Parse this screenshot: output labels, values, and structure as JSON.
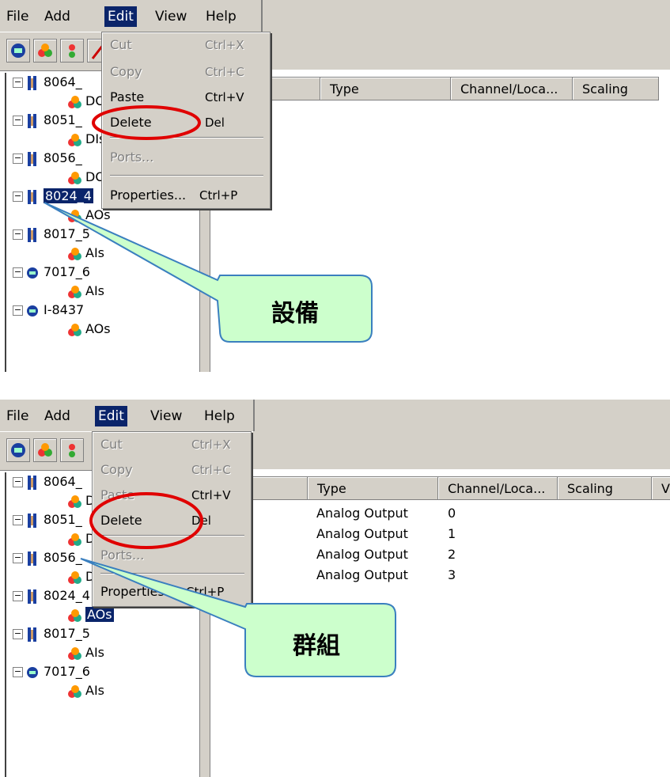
{
  "menu": [
    "File",
    "Add",
    "Edit",
    "View",
    "Help"
  ],
  "edit_menu": {
    "cut": "Cut",
    "cut_sc": "Ctrl+X",
    "copy": "Copy",
    "copy_sc": "Ctrl+C",
    "paste": "Paste",
    "paste_sc": "Ctrl+V",
    "delete": "Delete",
    "delete_sc": "Del",
    "ports": "Ports...",
    "properties": "Properties...",
    "properties_sc": "Ctrl+P"
  },
  "tree": [
    {
      "device": "8064_",
      "group": "DO"
    },
    {
      "device": "8051_",
      "group": "DIs"
    },
    {
      "device": "8056_",
      "group": "DO"
    },
    {
      "device": "8024_4",
      "group": "AOs"
    },
    {
      "device": "8017_5",
      "group": "AIs"
    },
    {
      "device": "7017_6",
      "group": "AIs"
    },
    {
      "device": "I-8437",
      "group": "AOs"
    }
  ],
  "columns": {
    "type": "Type",
    "channel": "Channel/Loca...",
    "scaling": "Scaling",
    "extra": "V"
  },
  "rows": [
    {
      "type": "Analog Output",
      "channel": "0"
    },
    {
      "type": "Analog Output",
      "channel": "1"
    },
    {
      "type": "Analog Output",
      "channel": "2"
    },
    {
      "type": "Analog Output",
      "channel": "3"
    }
  ],
  "callouts": {
    "device": "設備",
    "group": "群組"
  },
  "colors": {
    "highlight": "#0a246a",
    "callout_fill": "#ccffcc",
    "callout_border": "#3a7fbf",
    "circle": "#e00000",
    "chrome": "#d4d0c8"
  }
}
